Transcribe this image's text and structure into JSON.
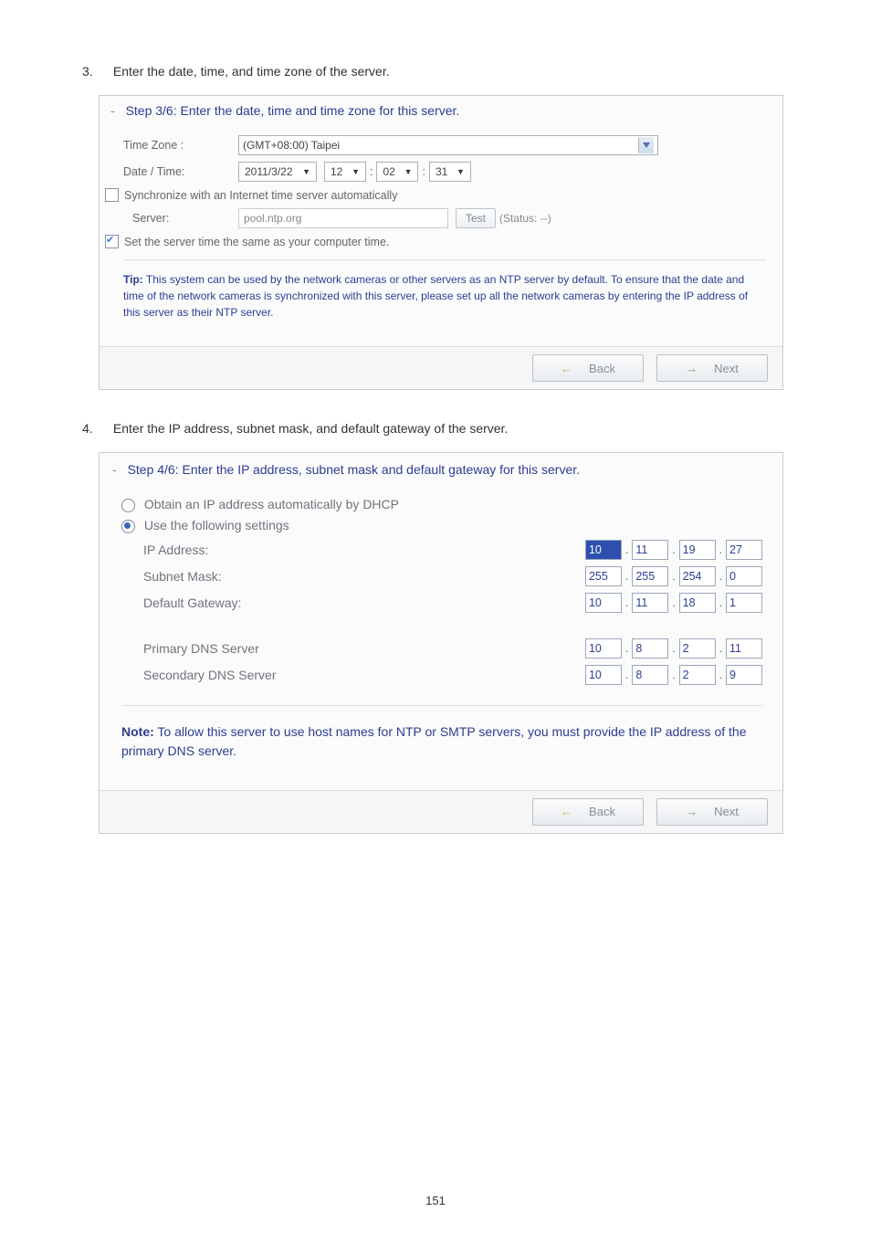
{
  "step3": {
    "num": "3.",
    "instruction": "Enter the date, time, and time zone of the server.",
    "dash": "-",
    "title": "Step 3/6: Enter the date, time and time zone for this server.",
    "tz_label": "Time Zone :",
    "tz_value": "(GMT+08:00) Taipei",
    "dt_label": "Date / Time:",
    "date_value": "2011/3/22",
    "hour": "12",
    "min": "02",
    "sec": "31",
    "sep": ":",
    "sync_label": "Synchronize with an Internet time server automatically",
    "server_label": "Server:",
    "server_value": "pool.ntp.org",
    "test_btn": "Test",
    "status": "(Status: --)",
    "sameas_label": "Set the server time the same as your computer time.",
    "tip_label": "Tip:",
    "tip_text": " This system can be used by the network cameras or other servers as an NTP server by default. To ensure that the date and time of the network cameras is synchronized with this server, please set up all the network cameras by entering the IP address of this server as their NTP server.",
    "back": "Back",
    "next": "Next"
  },
  "step4": {
    "num": "4.",
    "instruction": "Enter the IP address, subnet mask, and default gateway of the server.",
    "dash": "-",
    "title": "Step 4/6: Enter the IP address, subnet mask and default gateway for this server.",
    "opt_dhcp": "Obtain an IP address automatically by DHCP",
    "opt_static": "Use the following settings",
    "ip_label": "IP Address:",
    "ip": [
      "10",
      "11",
      "19",
      "27"
    ],
    "mask_label": "Subnet Mask:",
    "mask": [
      "255",
      "255",
      "254",
      "0"
    ],
    "gw_label": "Default Gateway:",
    "gw": [
      "10",
      "11",
      "18",
      "1"
    ],
    "dns1_label": "Primary DNS Server",
    "dns1": [
      "10",
      "8",
      "2",
      "11"
    ],
    "dns2_label": "Secondary DNS Server",
    "dns2": [
      "10",
      "8",
      "2",
      "9"
    ],
    "dot": ".",
    "note_label": "Note:",
    "note_text": " To allow this server to use host names for NTP or SMTP servers, you must provide the IP address of the primary DNS server.",
    "back": "Back",
    "next": "Next"
  },
  "page_number": "151"
}
